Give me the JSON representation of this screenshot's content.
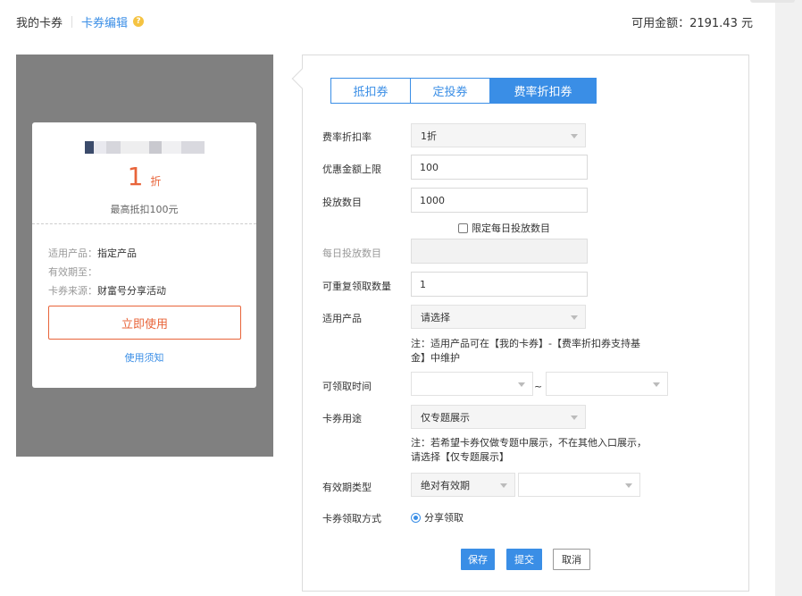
{
  "header": {
    "crumb_my_cards": "我的卡券",
    "crumb_edit": "卡券编辑",
    "help_icon": "?",
    "balance": "可用金额：2191.43 元"
  },
  "preview": {
    "amount": "1",
    "amount_unit": "折",
    "max_deduct": "最高抵扣100元",
    "product_label": "适用产品：",
    "product_value": "指定产品",
    "valid_label": "有效期至：",
    "valid_value": "",
    "source_label": "卡券来源：",
    "source_value": "财富号分享活动",
    "use_button": "立即使用",
    "use_note": "使用须知"
  },
  "tabs": [
    {
      "label": "抵扣券",
      "active": false
    },
    {
      "label": "定投券",
      "active": false
    },
    {
      "label": "费率折扣券",
      "active": true
    }
  ],
  "form": {
    "discount_rate": {
      "label": "费率折扣率",
      "value": "1折"
    },
    "max_amount": {
      "label": "优惠金额上限",
      "value": "100"
    },
    "issue_count": {
      "label": "投放数目",
      "value": "1000"
    },
    "limit_daily": {
      "label": "限定每日投放数目",
      "checked": false
    },
    "daily_count": {
      "label": "每日投放数目",
      "value": ""
    },
    "repeat_count": {
      "label": "可重复领取数量",
      "value": "1"
    },
    "product": {
      "label": "适用产品",
      "value": "请选择"
    },
    "product_note": "注：适用产品可在【我的卡券】-【费率折扣券支持基金】中维护",
    "claim_time": {
      "label": "可领取时间",
      "start": "",
      "end": "",
      "separator": "~"
    },
    "usage": {
      "label": "卡券用途",
      "value": "仅专题展示"
    },
    "usage_note": "注：若希望卡券仅做专题中展示，不在其他入口展示，请选择【仅专题展示】",
    "valid_type": {
      "label": "有效期类型",
      "value": "绝对有效期",
      "second": ""
    },
    "claim_method": {
      "label": "卡券领取方式",
      "option": "分享领取"
    }
  },
  "buttons": {
    "save": "保存",
    "submit": "提交",
    "cancel": "取消"
  },
  "colors": {
    "accent": "#3a8ee6",
    "coupon": "#e8643a",
    "preview_bg": "#808080"
  }
}
